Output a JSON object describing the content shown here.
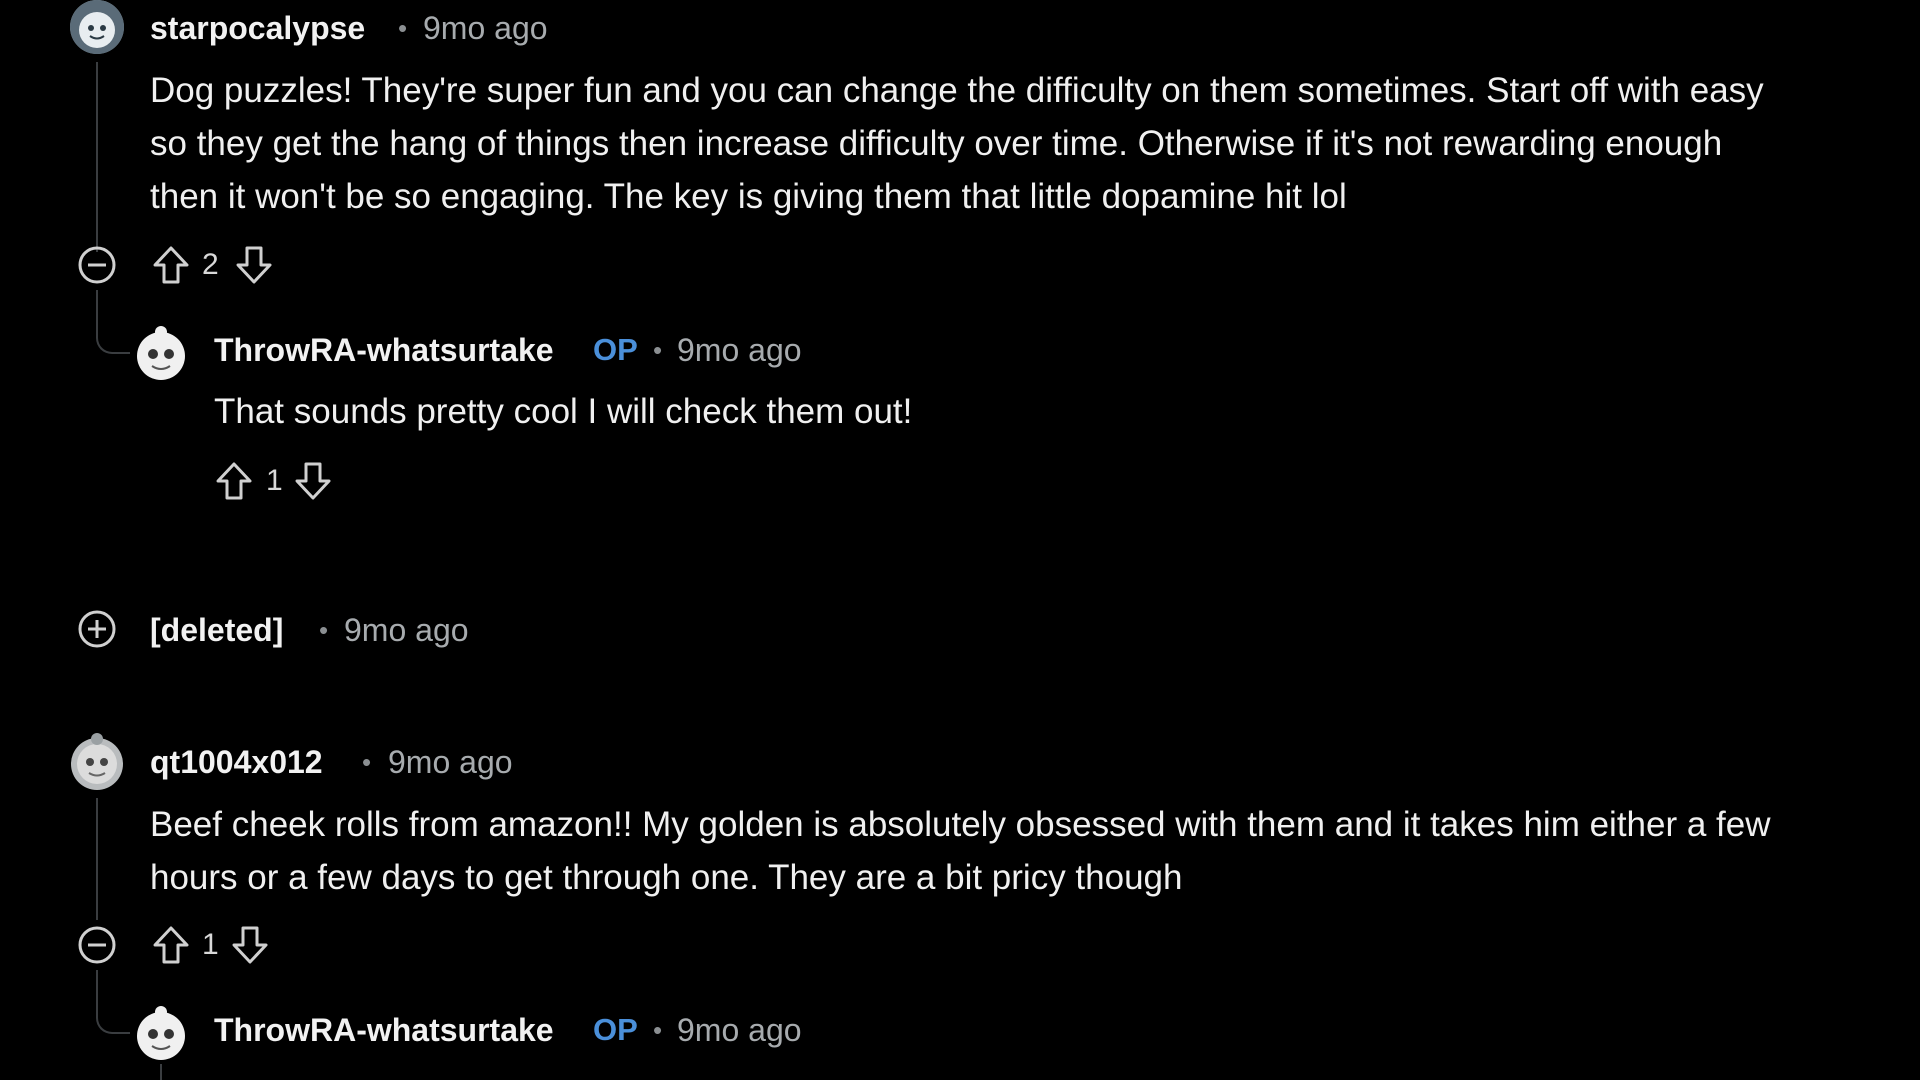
{
  "comments": [
    {
      "author": "starpocalypse",
      "separator": "•",
      "time": "9mo ago",
      "lines": [
        "Dog puzzles! They're super fun and you can change the difficulty on them sometimes. Start off with easy",
        "so they get the hang of things then increase difficulty over time. Otherwise if it's not rewarding enough",
        "then it won't be so engaging. The key is giving them that little dopamine hit lol"
      ],
      "votes": "2",
      "replies": [
        {
          "author": "ThrowRA-whatsurtake",
          "badge": "OP",
          "separator": "•",
          "time": "9mo ago",
          "text": "That sounds pretty cool I will check them out!",
          "votes": "1"
        }
      ]
    },
    {
      "author": "[deleted]",
      "separator": "•",
      "time": "9mo ago",
      "collapsed": true
    },
    {
      "author": "qt1004x012",
      "separator": "•",
      "time": "9mo ago",
      "lines": [
        "Beef cheek rolls from amazon!! My golden is absolutely obsessed with them and it takes him either a few",
        "hours or a few days to get through one. They are a bit pricy though"
      ],
      "votes": "1",
      "replies": [
        {
          "author": "ThrowRA-whatsurtake",
          "badge": "OP",
          "separator": "•",
          "time": "9mo ago"
        }
      ]
    }
  ],
  "icons": {
    "collapse": "minus-circle-icon",
    "expand": "plus-circle-icon",
    "upvote": "arrow-up-icon",
    "downvote": "arrow-down-icon"
  },
  "colors": {
    "background": "#000000",
    "op_badge": "#4a8fd9",
    "muted_text": "#a7abae",
    "thread_line": "#3a3d40"
  }
}
